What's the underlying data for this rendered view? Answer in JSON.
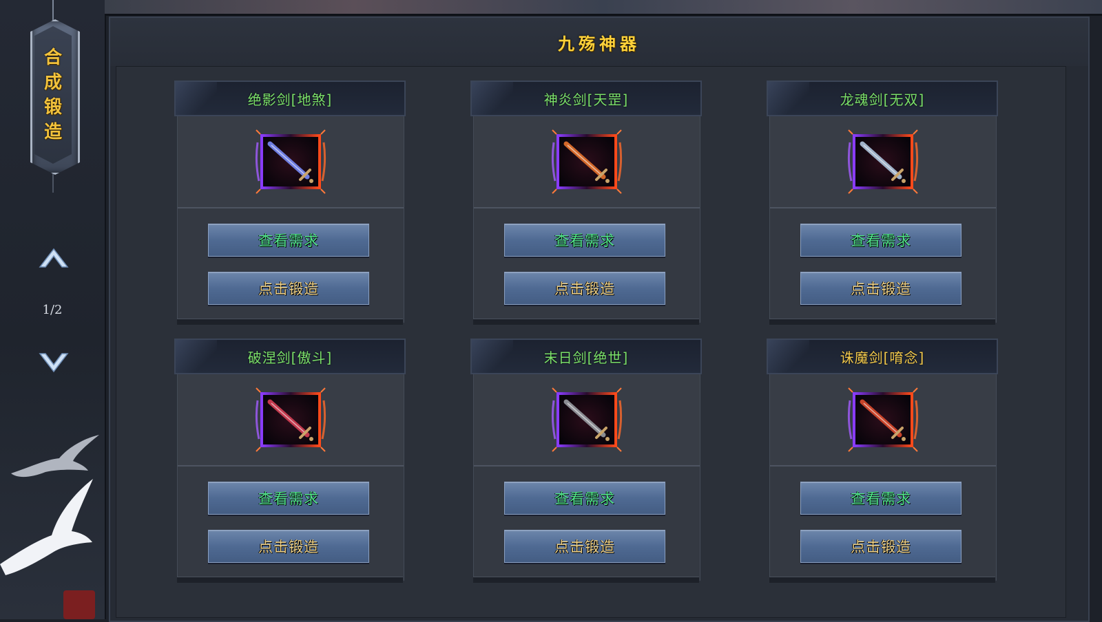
{
  "sidebar": {
    "plaque_chars": [
      "合",
      "成",
      "锻",
      "造"
    ],
    "page_indicator": "1/2",
    "up_icon": "chevron-up-icon",
    "down_icon": "chevron-down-icon"
  },
  "panel": {
    "title": "九殇神器"
  },
  "cards": [
    {
      "name": "绝影剑[地煞]",
      "name_color": "green",
      "blade": "#6f7ee0",
      "view_label": "查看需求",
      "forge_label": "点击锻造"
    },
    {
      "name": "神炎剑[天罡]",
      "name_color": "green",
      "blade": "#d2682a",
      "view_label": "查看需求",
      "forge_label": "点击锻造"
    },
    {
      "name": "龙魂剑[无双]",
      "name_color": "green",
      "blade": "#9fb2c8",
      "view_label": "查看需求",
      "forge_label": "点击锻造"
    },
    {
      "name": "破涅剑[傲斗]",
      "name_color": "green",
      "blade": "#c23a4e",
      "view_label": "查看需求",
      "forge_label": "点击锻造"
    },
    {
      "name": "末日剑[绝世]",
      "name_color": "green",
      "blade": "#8a8c92",
      "view_label": "查看需求",
      "forge_label": "点击锻造"
    },
    {
      "name": "诛魔剑[唷念]",
      "name_color": "gold",
      "blade": "#c8442a",
      "view_label": "查看需求",
      "forge_label": "点击锻造"
    }
  ],
  "colors": {
    "title_gold": "#ffd23a",
    "name_green": "#7be06a",
    "name_gold": "#f2c94c",
    "view_text": "#52e68c",
    "forge_text": "#f0d38a",
    "button_blue": "#5772a0",
    "frame_purple": "#8a3cff",
    "frame_red": "#ff4a1a"
  }
}
